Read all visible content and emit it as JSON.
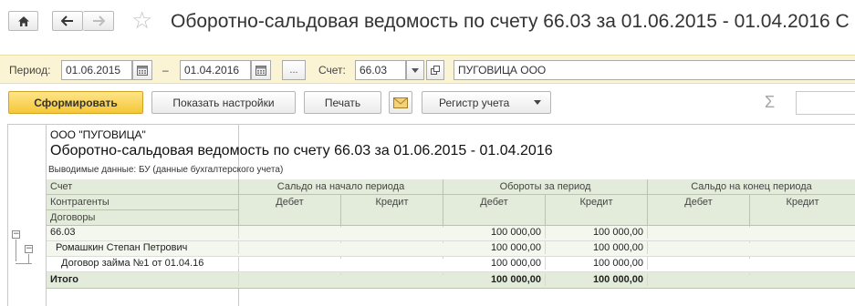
{
  "window": {
    "title": "Оборотно-сальдовая ведомость по счету 66.03 за 01.06.2015 - 01.04.2016 С"
  },
  "filters": {
    "period_label": "Период:",
    "date_from": "01.06.2015",
    "dash": "–",
    "date_to": "01.04.2016",
    "more": "...",
    "account_label": "Счет:",
    "account": "66.03",
    "counterparty": "ПУГОВИЦА ООО"
  },
  "toolbar": {
    "generate": "Сформировать",
    "settings": "Показать настройки",
    "print": "Печать",
    "register": "Регистр учета"
  },
  "report": {
    "org": "ООО \"ПУГОВИЦА\"",
    "title": "Оборотно-сальдовая ведомость по счету 66.03 за 01.06.2015 - 01.04.2016",
    "subtitle": "Выводимые данные:  БУ (данные бухгалтерского учета)",
    "headers": {
      "account": "Счет",
      "counterparties": "Контрагенты",
      "contracts": "Договоры",
      "opening": "Сальдо на начало периода",
      "turnover": "Обороты за период",
      "closing": "Сальдо на конец периода",
      "debit": "Дебет",
      "credit": "Кредит"
    },
    "rows": [
      {
        "name": "66.03",
        "opening_debit": "",
        "opening_credit": "",
        "turnover_debit": "100 000,00",
        "turnover_credit": "100 000,00",
        "closing_debit": "",
        "closing_credit": ""
      },
      {
        "name": "Ромашкин Степан Петрович",
        "opening_debit": "",
        "opening_credit": "",
        "turnover_debit": "100 000,00",
        "turnover_credit": "100 000,00",
        "closing_debit": "",
        "closing_credit": ""
      },
      {
        "name": "Договор займа №1 от 01.04.16",
        "opening_debit": "",
        "opening_credit": "",
        "turnover_debit": "100 000,00",
        "turnover_credit": "100 000,00",
        "closing_debit": "",
        "closing_credit": ""
      }
    ],
    "total": {
      "name": "Итого",
      "turnover_debit": "100 000,00",
      "turnover_credit": "100 000,00"
    }
  }
}
